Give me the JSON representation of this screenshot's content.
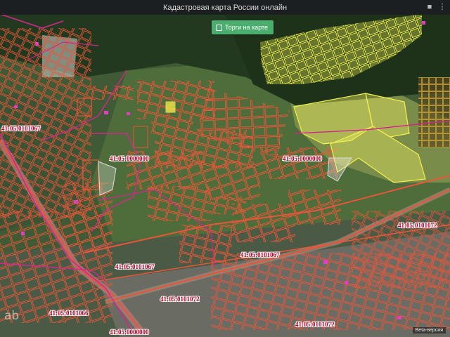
{
  "title": "Кадастровая карта России онлайн",
  "auction_button": "Торги на карте",
  "beta_label": "Beta-версия",
  "logo_text": "ab",
  "cadastral_labels": [
    "41:05:0101067",
    "41:05:0000000",
    "41:05:0000000",
    "41:05:0101072",
    "41:05:0101067",
    "41:05:0101067",
    "41:05:0101072",
    "41:05:0101066",
    "41:05:0101072",
    "41:05:0000000"
  ],
  "colors": {
    "parcel_outline": "#e8563a",
    "highlight_parcel": "#f2f24a",
    "boundary_line": "#d2288c",
    "label_text": "#b0002a",
    "auction_button": "#4cae6e"
  }
}
